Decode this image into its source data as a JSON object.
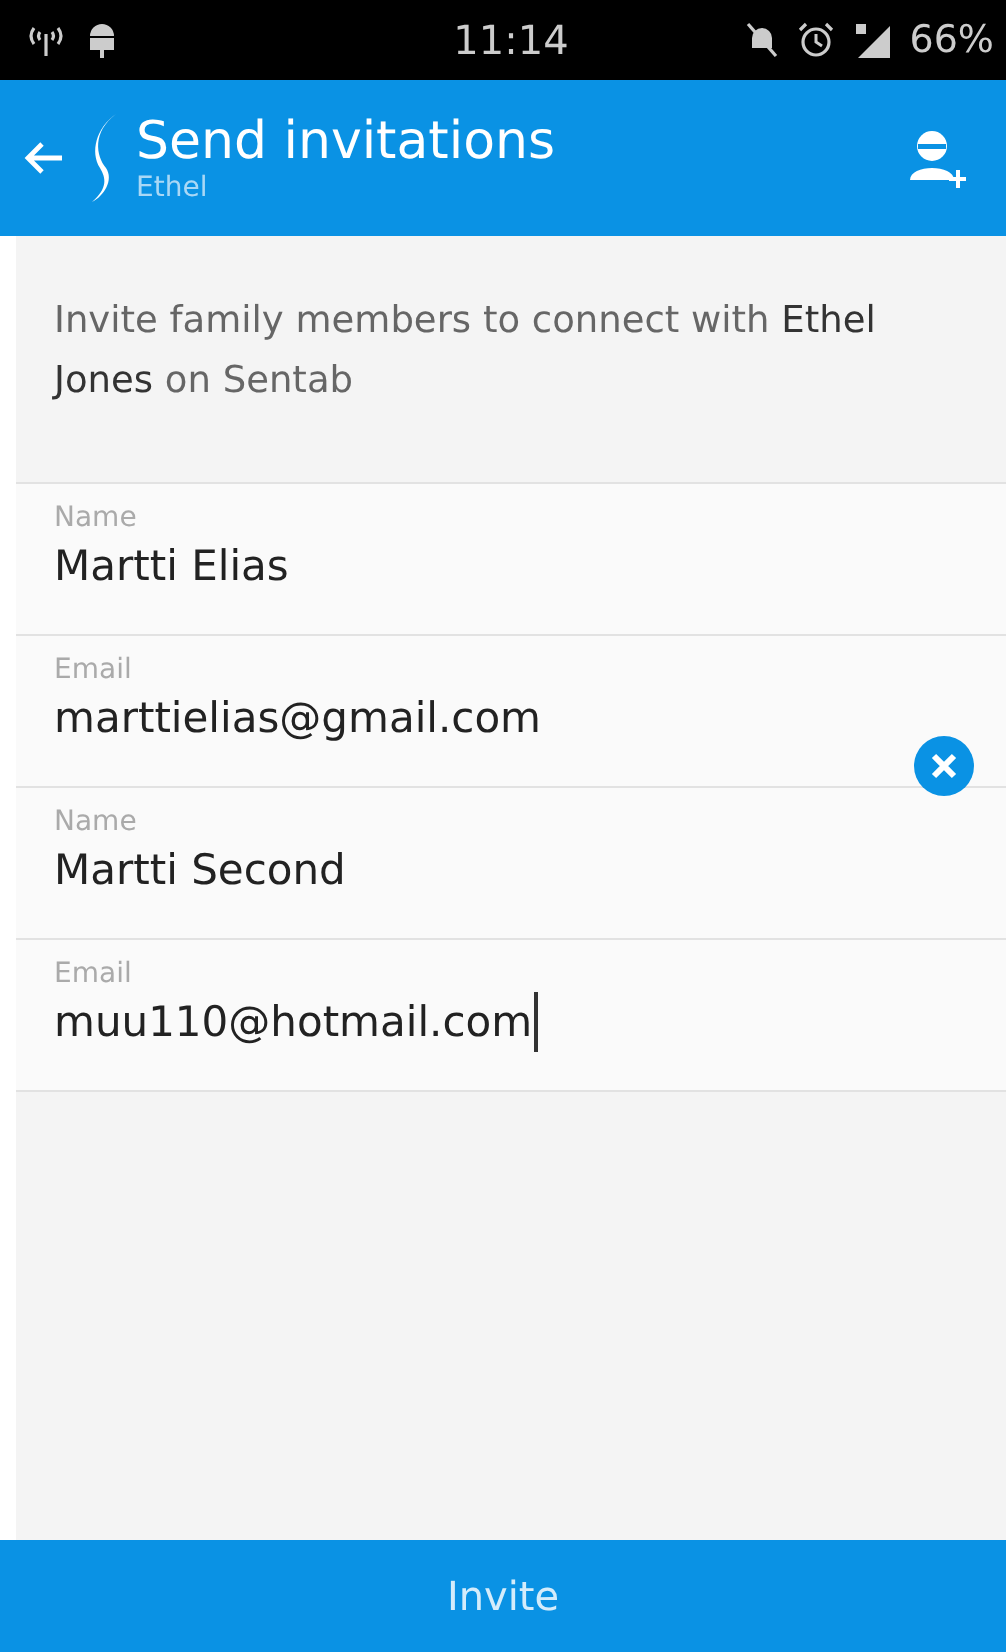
{
  "status_bar": {
    "time": "11:14",
    "battery": "66%"
  },
  "app_bar": {
    "title": "Send invitations",
    "subtitle": "Ethel"
  },
  "intro": "Invite family members to connect with **Ethel Jones** on Sentab",
  "invitees": [
    {
      "removable": false,
      "fields": [
        {
          "label": "Name",
          "value": "Martti Elias",
          "focused": false
        },
        {
          "label": "Email",
          "value": "marttielias@gmail.com",
          "focused": false
        }
      ]
    },
    {
      "removable": true,
      "fields": [
        {
          "label": "Name",
          "value": "Martti Second",
          "focused": false
        },
        {
          "label": "Email",
          "value": "muu110@hotmail.com",
          "focused": true
        }
      ]
    }
  ],
  "action_button": "Invite"
}
